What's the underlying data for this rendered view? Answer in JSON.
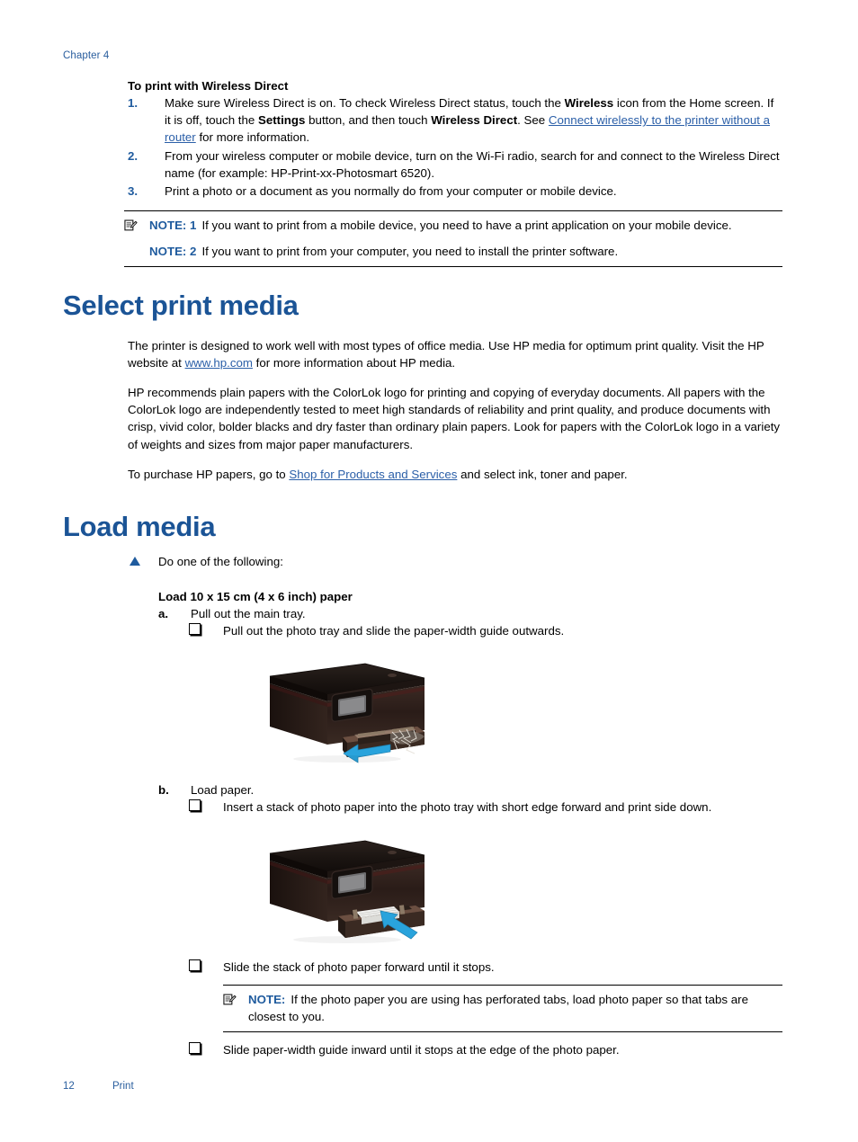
{
  "header": {
    "chapter": "Chapter 4"
  },
  "wireless_direct": {
    "title": "To print with Wireless Direct",
    "steps": [
      {
        "marker": "1.",
        "parts": [
          {
            "t": "Make sure Wireless Direct is on. To check Wireless Direct status, touch the ",
            "s": "normal"
          },
          {
            "t": "Wireless",
            "s": "bold"
          },
          {
            "t": " icon from the Home screen. If it is off, touch the ",
            "s": "normal"
          },
          {
            "t": "Settings",
            "s": "bold"
          },
          {
            "t": " button, and then touch ",
            "s": "normal"
          },
          {
            "t": "Wireless Direct",
            "s": "bold"
          },
          {
            "t": ". See ",
            "s": "normal"
          },
          {
            "t": "Connect wirelessly to the printer without a router",
            "s": "link"
          },
          {
            "t": " for more information.",
            "s": "normal"
          }
        ]
      },
      {
        "marker": "2.",
        "parts": [
          {
            "t": "From your wireless computer or mobile device, turn on the Wi-Fi radio, search for and connect to the Wireless Direct name (for example: HP-Print-xx-Photosmart 6520).",
            "s": "normal"
          }
        ]
      },
      {
        "marker": "3.",
        "parts": [
          {
            "t": "Print a photo or a document as you normally do from your computer or mobile device.",
            "s": "normal"
          }
        ]
      }
    ],
    "notes": [
      {
        "icon": "note-pencil-icon",
        "label": "NOTE: 1",
        "text": "If you want to print from a mobile device, you need to have a print application on your mobile device."
      },
      {
        "icon": "",
        "label": "NOTE: 2",
        "text": "If you want to print from your computer, you need to install the printer software."
      }
    ]
  },
  "select_print_media": {
    "heading": "Select print media",
    "para1_a": "The printer is designed to work well with most types of office media. Use HP media for optimum print quality. Visit the HP website at ",
    "para1_link": "www.hp.com",
    "para1_b": " for more information about HP media.",
    "para2": "HP recommends plain papers with the ColorLok logo for printing and copying of everyday documents. All papers with the ColorLok logo are independently tested to meet high standards of reliability and print quality, and produce documents with crisp, vivid color, bolder blacks and dry faster than ordinary plain papers. Look for papers with the ColorLok logo in a variety of weights and sizes from major paper manufacturers.",
    "para3_a": "To purchase HP papers, go to ",
    "para3_link": "Shop for Products and Services",
    "para3_b": " and select ink, toner and paper."
  },
  "load_media": {
    "heading": "Load media",
    "intro_bullet": "triangle-bullet-icon",
    "intro": "Do one of the following:",
    "subsection_title": "Load 10 x 15 cm (4 x 6 inch) paper",
    "step_a": {
      "marker": "a.",
      "text": "Pull out the main tray.",
      "bullets": [
        "Pull out the photo tray and slide the paper-width guide outwards."
      ],
      "figure": "printer-pull-out-photo-tray-illustration"
    },
    "step_b": {
      "marker": "b.",
      "text": "Load paper.",
      "bullets": [
        "Insert a stack of photo paper into the photo tray with short edge forward and print side down."
      ],
      "figure": "printer-insert-photo-paper-illustration",
      "bullets_after": [
        "Slide the stack of photo paper forward until it stops."
      ],
      "note": {
        "icon": "note-pencil-icon",
        "label": "NOTE:",
        "text": "If the photo paper you are using has perforated tabs, load photo paper so that tabs are closest to you."
      },
      "bullets_last": [
        "Slide paper-width guide inward until it stops at the edge of the photo paper."
      ]
    }
  },
  "footer": {
    "page_number": "12",
    "section": "Print"
  },
  "colors": {
    "heading_blue": "#1b5496",
    "link_blue": "#2b5fa8",
    "marker_blue": "#1f5b9e",
    "header_blue": "#2a5e9e",
    "rule_black": "#000000"
  }
}
